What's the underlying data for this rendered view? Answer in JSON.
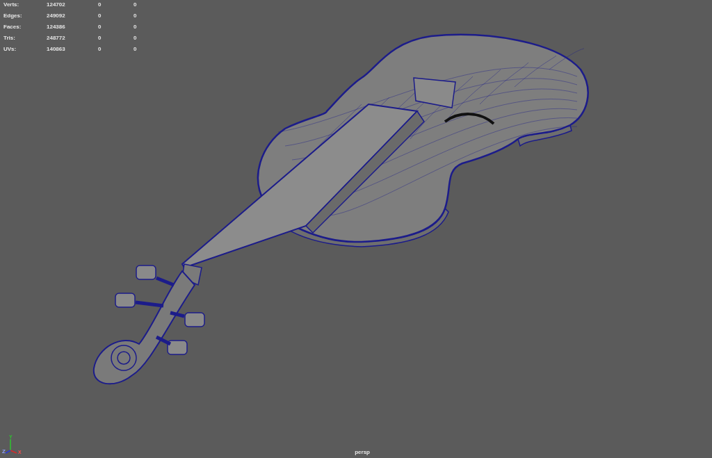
{
  "stats": [
    {
      "label": "Verts:",
      "value": "124702",
      "column_3": "0",
      "column_4": "0"
    },
    {
      "label": "Edges:",
      "value": "249092",
      "column_3": "0",
      "column_4": "0"
    },
    {
      "label": "Faces:",
      "value": "124386",
      "column_3": "0",
      "column_4": "0"
    },
    {
      "label": "Tris:",
      "value": "248772",
      "column_3": "0",
      "column_4": "0"
    },
    {
      "label": "UVs:",
      "value": "140863",
      "column_3": "0",
      "column_4": "0"
    }
  ],
  "axis_gizmo": {
    "x": "X",
    "y": "Y",
    "z": "Z"
  },
  "camera_label": "persp"
}
